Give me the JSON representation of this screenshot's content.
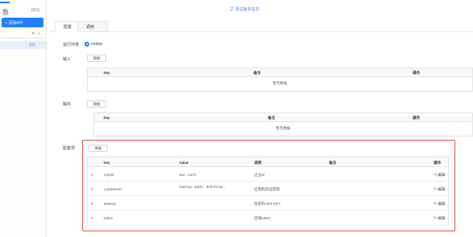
{
  "sidebar": {
    "title": "数",
    "count": "(0/1)",
    "add_button": "+ 添加API",
    "search_clear": "✕",
    "search_icon": "search-icon",
    "item_tag": "启用"
  },
  "topbar": {
    "link_text": "调试版本信息"
  },
  "tabs": [
    {
      "label": "配置"
    },
    {
      "label": "调用"
    }
  ],
  "form": {
    "runtime_label": "运行环境",
    "runtime_value": "nodejs",
    "input_label": "输入",
    "output_label": "输出",
    "config_label": "配置项",
    "add_label": "添加"
  },
  "io_table": {
    "headers": [
      "key",
      "备注",
      "操作"
    ],
    "empty_text": "暂无数据"
  },
  "config_table": {
    "headers": [
      "key",
      "value",
      "说明",
      "备注",
      "操作"
    ],
    "rows": [
      {
        "index": "1",
        "key": "corpId",
        "value": "ww....ca72",
        "desc": "企业id",
        "note": "",
        "action": "编辑"
      },
      {
        "index": "2",
        "key": "corpSecret",
        "value": "0a0Aax...0dcb... 8cfLTCA5...",
        "desc": "应用的凭证密钥",
        "note": "",
        "action": "编辑"
      },
      {
        "index": "3",
        "key": "aesKey",
        "value": "",
        "desc": "加密的AES KEY",
        "note": "",
        "action": "编辑"
      },
      {
        "index": "4",
        "key": "token",
        "value": "",
        "desc": "回调token",
        "note": "",
        "action": "编辑"
      }
    ]
  },
  "colors": {
    "accent": "#1f7fff",
    "highlight": "#e05343"
  }
}
